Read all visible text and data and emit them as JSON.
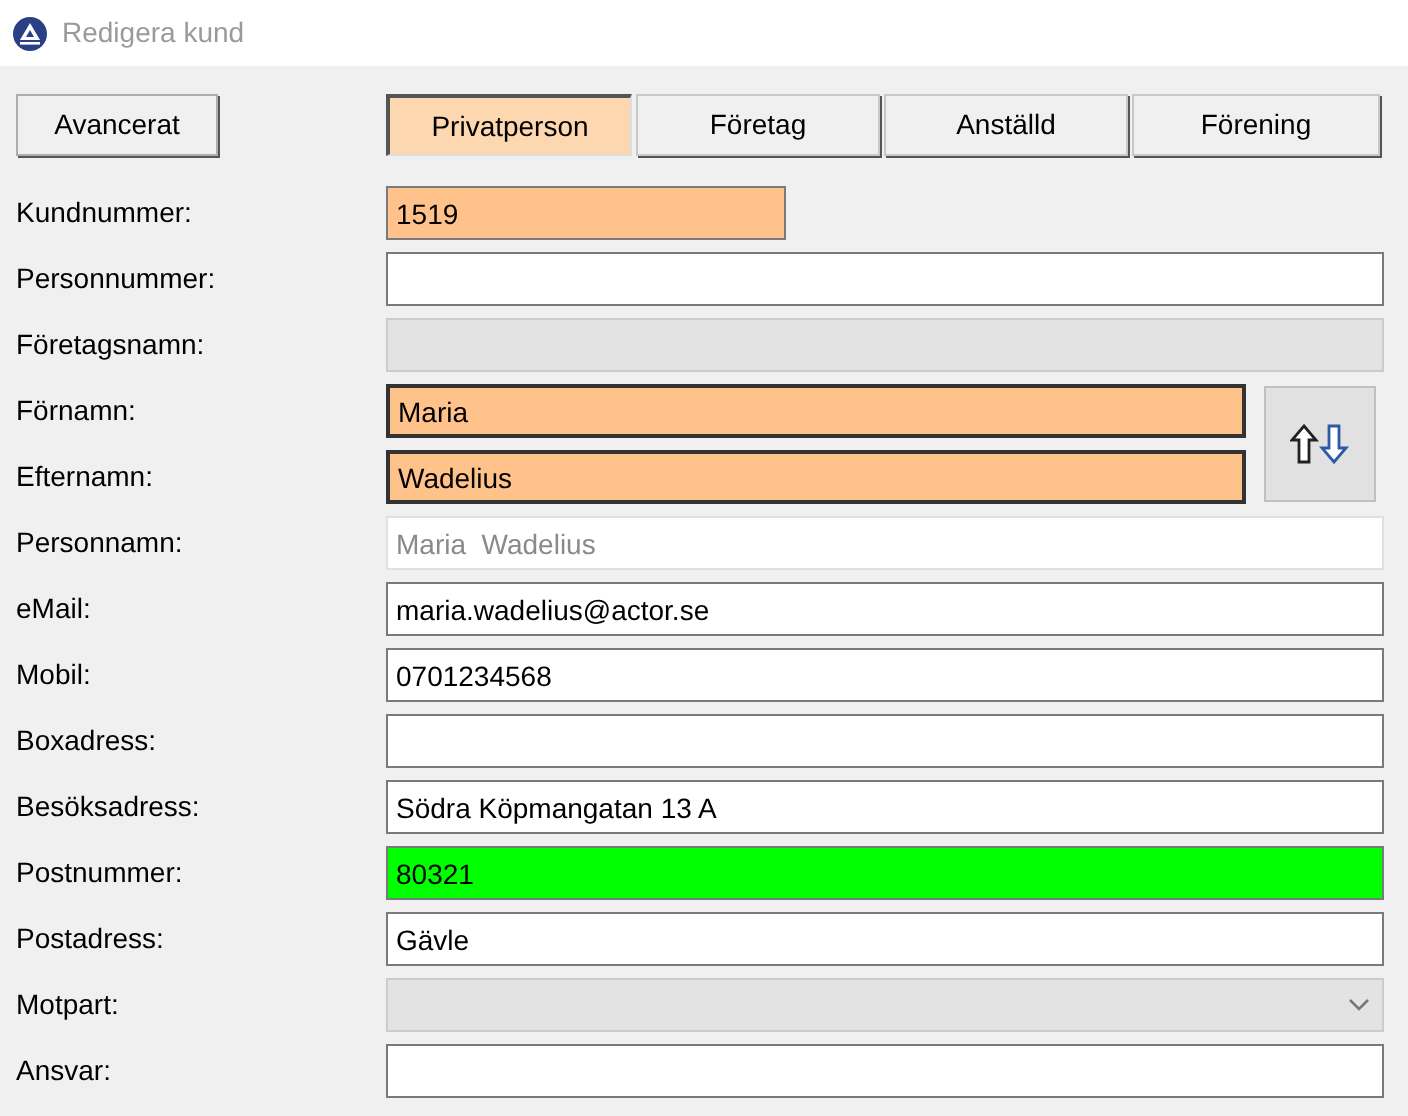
{
  "window": {
    "title": "Redigera kund"
  },
  "advanced_button": "Avancerat",
  "tabs": [
    {
      "label": "Privatperson",
      "selected": true
    },
    {
      "label": "Företag",
      "selected": false
    },
    {
      "label": "Anställd",
      "selected": false
    },
    {
      "label": "Förening",
      "selected": false
    }
  ],
  "fields": [
    {
      "label": "Kundnummer:",
      "kind": "short",
      "value": "1519",
      "disabled": false,
      "readonly": false,
      "color": "#ffc28a"
    },
    {
      "label": "Personnummer:",
      "kind": "text",
      "disabled": false,
      "readonly": false
    },
    {
      "label": "Företagsnamn:",
      "kind": "text",
      "disabled": true,
      "readonly": false
    },
    {
      "label": "Förnamn:",
      "kind": "name",
      "value": "Maria",
      "disabled": false,
      "readonly": false,
      "color": "#ffc28a"
    },
    {
      "label": "Efternamn:",
      "kind": "name",
      "value": "Wadelius",
      "disabled": false,
      "readonly": false,
      "color": "#ffc28a"
    },
    {
      "label": "Personnamn:",
      "kind": "text",
      "value": "Maria  Wadelius",
      "disabled": false,
      "readonly": true
    },
    {
      "label": "eMail:",
      "kind": "text",
      "value": "maria.wadelius@actor.se",
      "disabled": false,
      "readonly": false
    },
    {
      "label": "Mobil:",
      "kind": "text",
      "value": "0701234568",
      "disabled": false,
      "readonly": false
    },
    {
      "label": "Boxadress:",
      "kind": "text",
      "disabled": false,
      "readonly": false
    },
    {
      "label": "Besöksadress:",
      "kind": "text",
      "value": "Södra Köpmangatan 13 A",
      "disabled": false,
      "readonly": false
    },
    {
      "label": "Postnummer:",
      "kind": "text",
      "value": "80321",
      "disabled": false,
      "readonly": false,
      "color": "#00ff00"
    },
    {
      "label": "Postadress:",
      "kind": "text",
      "value": "Gävle",
      "disabled": false,
      "readonly": false
    },
    {
      "label": "Motpart:",
      "kind": "dropdown",
      "disabled": true,
      "readonly": false
    },
    {
      "label": "Ansvar:",
      "kind": "text",
      "disabled": false,
      "readonly": false
    }
  ]
}
